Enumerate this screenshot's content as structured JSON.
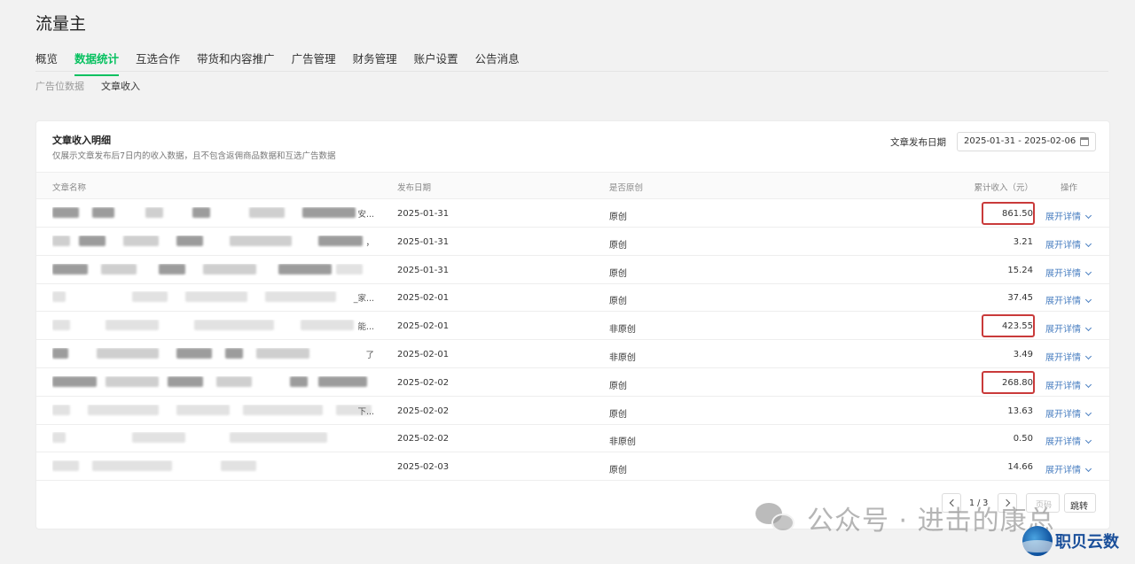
{
  "app": {
    "title": "流量主"
  },
  "nav": {
    "tabs": [
      {
        "label": "概览"
      },
      {
        "label": "数据统计"
      },
      {
        "label": "互选合作"
      },
      {
        "label": "带货和内容推广"
      },
      {
        "label": "广告管理"
      },
      {
        "label": "财务管理"
      },
      {
        "label": "账户设置"
      },
      {
        "label": "公告消息"
      }
    ],
    "active_index": 1
  },
  "subnav": {
    "items": [
      {
        "label": "广告位数据"
      },
      {
        "label": "文章收入"
      }
    ],
    "active_index": 1
  },
  "card": {
    "title": "文章收入明细",
    "subtitle": "仅展示文章发布后7日内的收入数据，且不包含返佣商品数据和互选广告数据",
    "filter_label": "文章发布日期",
    "date_range": "2025-01-31 - 2025-02-06",
    "date_icon": "calendar-icon"
  },
  "table": {
    "headers": {
      "name": "文章名称",
      "date": "发布日期",
      "original": "是否原创",
      "income": "累计收入（元）",
      "op": "操作"
    },
    "rows": [
      {
        "name_tail": "安...",
        "date": "2025-01-31",
        "original": "原创",
        "income": "861.50",
        "op": "展开详情",
        "highlighted": true
      },
      {
        "name_tail": "，",
        "date": "2025-01-31",
        "original": "原创",
        "income": "3.21",
        "op": "展开详情",
        "highlighted": false
      },
      {
        "name_tail": "",
        "date": "2025-01-31",
        "original": "原创",
        "income": "15.24",
        "op": "展开详情",
        "highlighted": false
      },
      {
        "name_tail": "_家...",
        "date": "2025-02-01",
        "original": "原创",
        "income": "37.45",
        "op": "展开详情",
        "highlighted": false
      },
      {
        "name_tail": "能...",
        "date": "2025-02-01",
        "original": "非原创",
        "income": "423.55",
        "op": "展开详情",
        "highlighted": true
      },
      {
        "name_tail": "了",
        "date": "2025-02-01",
        "original": "非原创",
        "income": "3.49",
        "op": "展开详情",
        "highlighted": false
      },
      {
        "name_tail": "",
        "date": "2025-02-02",
        "original": "原创",
        "income": "268.80",
        "op": "展开详情",
        "highlighted": true
      },
      {
        "name_tail": "下...",
        "date": "2025-02-02",
        "original": "原创",
        "income": "13.63",
        "op": "展开详情",
        "highlighted": false
      },
      {
        "name_tail": "",
        "date": "2025-02-02",
        "original": "非原创",
        "income": "0.50",
        "op": "展开详情",
        "highlighted": false
      },
      {
        "name_tail": "",
        "date": "2025-02-03",
        "original": "原创",
        "income": "14.66",
        "op": "展开详情",
        "highlighted": false
      }
    ]
  },
  "pagination": {
    "current": "1 / 3",
    "input_placeholder": "页码",
    "jump_label": "跳转"
  },
  "watermark": {
    "text": "公众号 · 进击的康总",
    "icon": "wechat-icon"
  },
  "brand": {
    "text": "职贝云数"
  },
  "colors": {
    "accent": "#07c160",
    "link": "#4a7fc1",
    "highlight": "#c93a3a"
  }
}
